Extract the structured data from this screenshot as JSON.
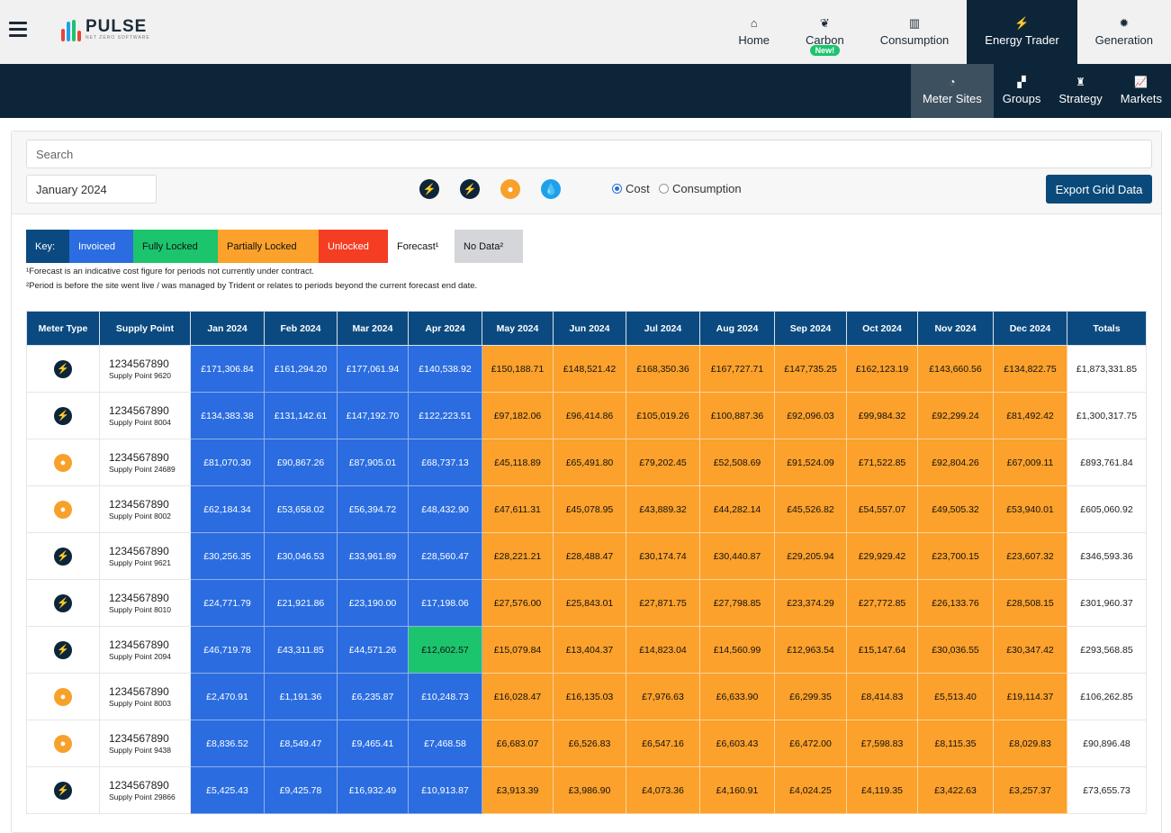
{
  "header": {
    "logo_title": "PULSE",
    "logo_subtitle": "NET ZERO SOFTWARE",
    "main_tabs": [
      {
        "label": "Home",
        "icon": "home-icon",
        "active": false
      },
      {
        "label": "Carbon",
        "icon": "leaf-icon",
        "badge": "New!",
        "active": false
      },
      {
        "label": "Consumption",
        "icon": "bar-chart-icon",
        "active": false
      },
      {
        "label": "Energy Trader",
        "icon": "bolt-icon",
        "active": true
      },
      {
        "label": "Generation",
        "icon": "gear-icon",
        "active": false
      }
    ],
    "sub_tabs": [
      {
        "label": "Meter Sites",
        "icon": "gauge-icon",
        "active": true
      },
      {
        "label": "Groups",
        "icon": "boxes-icon",
        "active": false
      },
      {
        "label": "Strategy",
        "icon": "chess-icon",
        "active": false
      },
      {
        "label": "Markets",
        "icon": "line-chart-icon",
        "active": false
      }
    ]
  },
  "toolbar": {
    "search_placeholder": "Search",
    "date_value": "January 2024",
    "filter_icons": [
      {
        "name": "electricity-hh-filter-icon",
        "color": "#0d2539"
      },
      {
        "name": "electricity-filter-icon",
        "color": "#0d2539"
      },
      {
        "name": "gas-filter-icon",
        "color": "#f7a12b"
      },
      {
        "name": "water-filter-icon",
        "color": "#1ea1ea"
      }
    ],
    "radio_cost": "Cost",
    "radio_consumption": "Consumption",
    "selected_mode": "Cost",
    "export_label": "Export Grid Data"
  },
  "key": {
    "label": "Key:",
    "items": [
      {
        "label": "Invoiced",
        "color": "#2b6de0"
      },
      {
        "label": "Fully Locked",
        "color": "#1cc46e"
      },
      {
        "label": "Partially Locked",
        "color": "#fca12b"
      },
      {
        "label": "Unlocked",
        "color": "#f43d23"
      },
      {
        "label": "Forecast¹",
        "color": "#ffffff"
      },
      {
        "label": "No Data²",
        "color": "#d4d6da"
      }
    ],
    "note1": "¹Forecast is an indicative cost figure for periods not currently under contract.",
    "note2": "²Period is before the site went live / was managed by Trident or relates to periods beyond the current forecast end date."
  },
  "table": {
    "columns": [
      "Meter Type",
      "Supply Point",
      "Jan 2024",
      "Feb 2024",
      "Mar 2024",
      "Apr 2024",
      "May 2024",
      "Jun 2024",
      "Jul 2024",
      "Aug 2024",
      "Sep 2024",
      "Oct 2024",
      "Nov 2024",
      "Dec 2024",
      "Totals"
    ],
    "rows": [
      {
        "meter_type": "electricity",
        "mpan": "1234567890",
        "name": "Supply Point 9620",
        "values": [
          "£171,306.84",
          "£161,294.20",
          "£177,061.94",
          "£140,538.92",
          "£150,188.71",
          "£148,521.42",
          "£168,350.36",
          "£167,727.71",
          "£147,735.25",
          "£162,123.19",
          "£143,660.56",
          "£134,822.75"
        ],
        "status": [
          "invoiced",
          "invoiced",
          "invoiced",
          "invoiced",
          "partially-locked",
          "partially-locked",
          "partially-locked",
          "partially-locked",
          "partially-locked",
          "partially-locked",
          "partially-locked",
          "partially-locked"
        ],
        "total": "£1,873,331.85"
      },
      {
        "meter_type": "electricity",
        "mpan": "1234567890",
        "name": "Supply Point 8004",
        "values": [
          "£134,383.38",
          "£131,142.61",
          "£147,192.70",
          "£122,223.51",
          "£97,182.06",
          "£96,414.86",
          "£105,019.26",
          "£100,887.36",
          "£92,096.03",
          "£99,984.32",
          "£92,299.24",
          "£81,492.42"
        ],
        "status": [
          "invoiced",
          "invoiced",
          "invoiced",
          "invoiced",
          "partially-locked",
          "partially-locked",
          "partially-locked",
          "partially-locked",
          "partially-locked",
          "partially-locked",
          "partially-locked",
          "partially-locked"
        ],
        "total": "£1,300,317.75"
      },
      {
        "meter_type": "gas",
        "mpan": "1234567890",
        "name": "Supply Point 24689",
        "values": [
          "£81,070.30",
          "£90,867.26",
          "£87,905.01",
          "£68,737.13",
          "£45,118.89",
          "£65,491.80",
          "£79,202.45",
          "£52,508.69",
          "£91,524.09",
          "£71,522.85",
          "£92,804.26",
          "£67,009.11"
        ],
        "status": [
          "invoiced",
          "invoiced",
          "invoiced",
          "invoiced",
          "partially-locked",
          "partially-locked",
          "partially-locked",
          "partially-locked",
          "partially-locked",
          "partially-locked",
          "partially-locked",
          "partially-locked"
        ],
        "total": "£893,761.84"
      },
      {
        "meter_type": "gas",
        "mpan": "1234567890",
        "name": "Supply Point 8002",
        "values": [
          "£62,184.34",
          "£53,658.02",
          "£56,394.72",
          "£48,432.90",
          "£47,611.31",
          "£45,078.95",
          "£43,889.32",
          "£44,282.14",
          "£45,526.82",
          "£54,557.07",
          "£49,505.32",
          "£53,940.01"
        ],
        "status": [
          "invoiced",
          "invoiced",
          "invoiced",
          "invoiced",
          "partially-locked",
          "partially-locked",
          "partially-locked",
          "partially-locked",
          "partially-locked",
          "partially-locked",
          "partially-locked",
          "partially-locked"
        ],
        "total": "£605,060.92"
      },
      {
        "meter_type": "electricity",
        "mpan": "1234567890",
        "name": "Supply Point 9621",
        "values": [
          "£30,256.35",
          "£30,046.53",
          "£33,961.89",
          "£28,560.47",
          "£28,221.21",
          "£28,488.47",
          "£30,174.74",
          "£30,440.87",
          "£29,205.94",
          "£29,929.42",
          "£23,700.15",
          "£23,607.32"
        ],
        "status": [
          "invoiced",
          "invoiced",
          "invoiced",
          "invoiced",
          "partially-locked",
          "partially-locked",
          "partially-locked",
          "partially-locked",
          "partially-locked",
          "partially-locked",
          "partially-locked",
          "partially-locked"
        ],
        "total": "£346,593.36"
      },
      {
        "meter_type": "electricity",
        "mpan": "1234567890",
        "name": "Supply Point 8010",
        "values": [
          "£24,771.79",
          "£21,921.86",
          "£23,190.00",
          "£17,198.06",
          "£27,576.00",
          "£25,843.01",
          "£27,871.75",
          "£27,798.85",
          "£23,374.29",
          "£27,772.85",
          "£26,133.76",
          "£28,508.15"
        ],
        "status": [
          "invoiced",
          "invoiced",
          "invoiced",
          "invoiced",
          "partially-locked",
          "partially-locked",
          "partially-locked",
          "partially-locked",
          "partially-locked",
          "partially-locked",
          "partially-locked",
          "partially-locked"
        ],
        "total": "£301,960.37"
      },
      {
        "meter_type": "electricity",
        "mpan": "1234567890",
        "name": "Supply Point 2094",
        "values": [
          "£46,719.78",
          "£43,311.85",
          "£44,571.26",
          "£12,602.57",
          "£15,079.84",
          "£13,404.37",
          "£14,823.04",
          "£14,560.99",
          "£12,963.54",
          "£15,147.64",
          "£30,036.55",
          "£30,347.42"
        ],
        "status": [
          "invoiced",
          "invoiced",
          "invoiced",
          "fully-locked",
          "partially-locked",
          "partially-locked",
          "partially-locked",
          "partially-locked",
          "partially-locked",
          "partially-locked",
          "partially-locked",
          "partially-locked"
        ],
        "total": "£293,568.85"
      },
      {
        "meter_type": "gas",
        "mpan": "1234567890",
        "name": "Supply Point 8003",
        "values": [
          "£2,470.91",
          "£1,191.36",
          "£6,235.87",
          "£10,248.73",
          "£16,028.47",
          "£16,135.03",
          "£7,976.63",
          "£6,633.90",
          "£6,299.35",
          "£8,414.83",
          "£5,513.40",
          "£19,114.37"
        ],
        "status": [
          "invoiced",
          "invoiced",
          "invoiced",
          "invoiced",
          "partially-locked",
          "partially-locked",
          "partially-locked",
          "partially-locked",
          "partially-locked",
          "partially-locked",
          "partially-locked",
          "partially-locked"
        ],
        "total": "£106,262.85"
      },
      {
        "meter_type": "gas",
        "mpan": "1234567890",
        "name": "Supply Point 9438",
        "values": [
          "£8,836.52",
          "£8,549.47",
          "£9,465.41",
          "£7,468.58",
          "£6,683.07",
          "£6,526.83",
          "£6,547.16",
          "£6,603.43",
          "£6,472.00",
          "£7,598.83",
          "£8,115.35",
          "£8,029.83"
        ],
        "status": [
          "invoiced",
          "invoiced",
          "invoiced",
          "invoiced",
          "partially-locked",
          "partially-locked",
          "partially-locked",
          "partially-locked",
          "partially-locked",
          "partially-locked",
          "partially-locked",
          "partially-locked"
        ],
        "total": "£90,896.48"
      },
      {
        "meter_type": "electricity",
        "mpan": "1234567890",
        "name": "Supply Point 29866",
        "values": [
          "£5,425.43",
          "£9,425.78",
          "£16,932.49",
          "£10,913.87",
          "£3,913.39",
          "£3,986.90",
          "£4,073.36",
          "£4,160.91",
          "£4,024.25",
          "£4,119.35",
          "£3,422.63",
          "£3,257.37"
        ],
        "status": [
          "invoiced",
          "invoiced",
          "invoiced",
          "invoiced",
          "partially-locked",
          "partially-locked",
          "partially-locked",
          "partially-locked",
          "partially-locked",
          "partially-locked",
          "partially-locked",
          "partially-locked"
        ],
        "total": "£73,655.73"
      }
    ]
  }
}
